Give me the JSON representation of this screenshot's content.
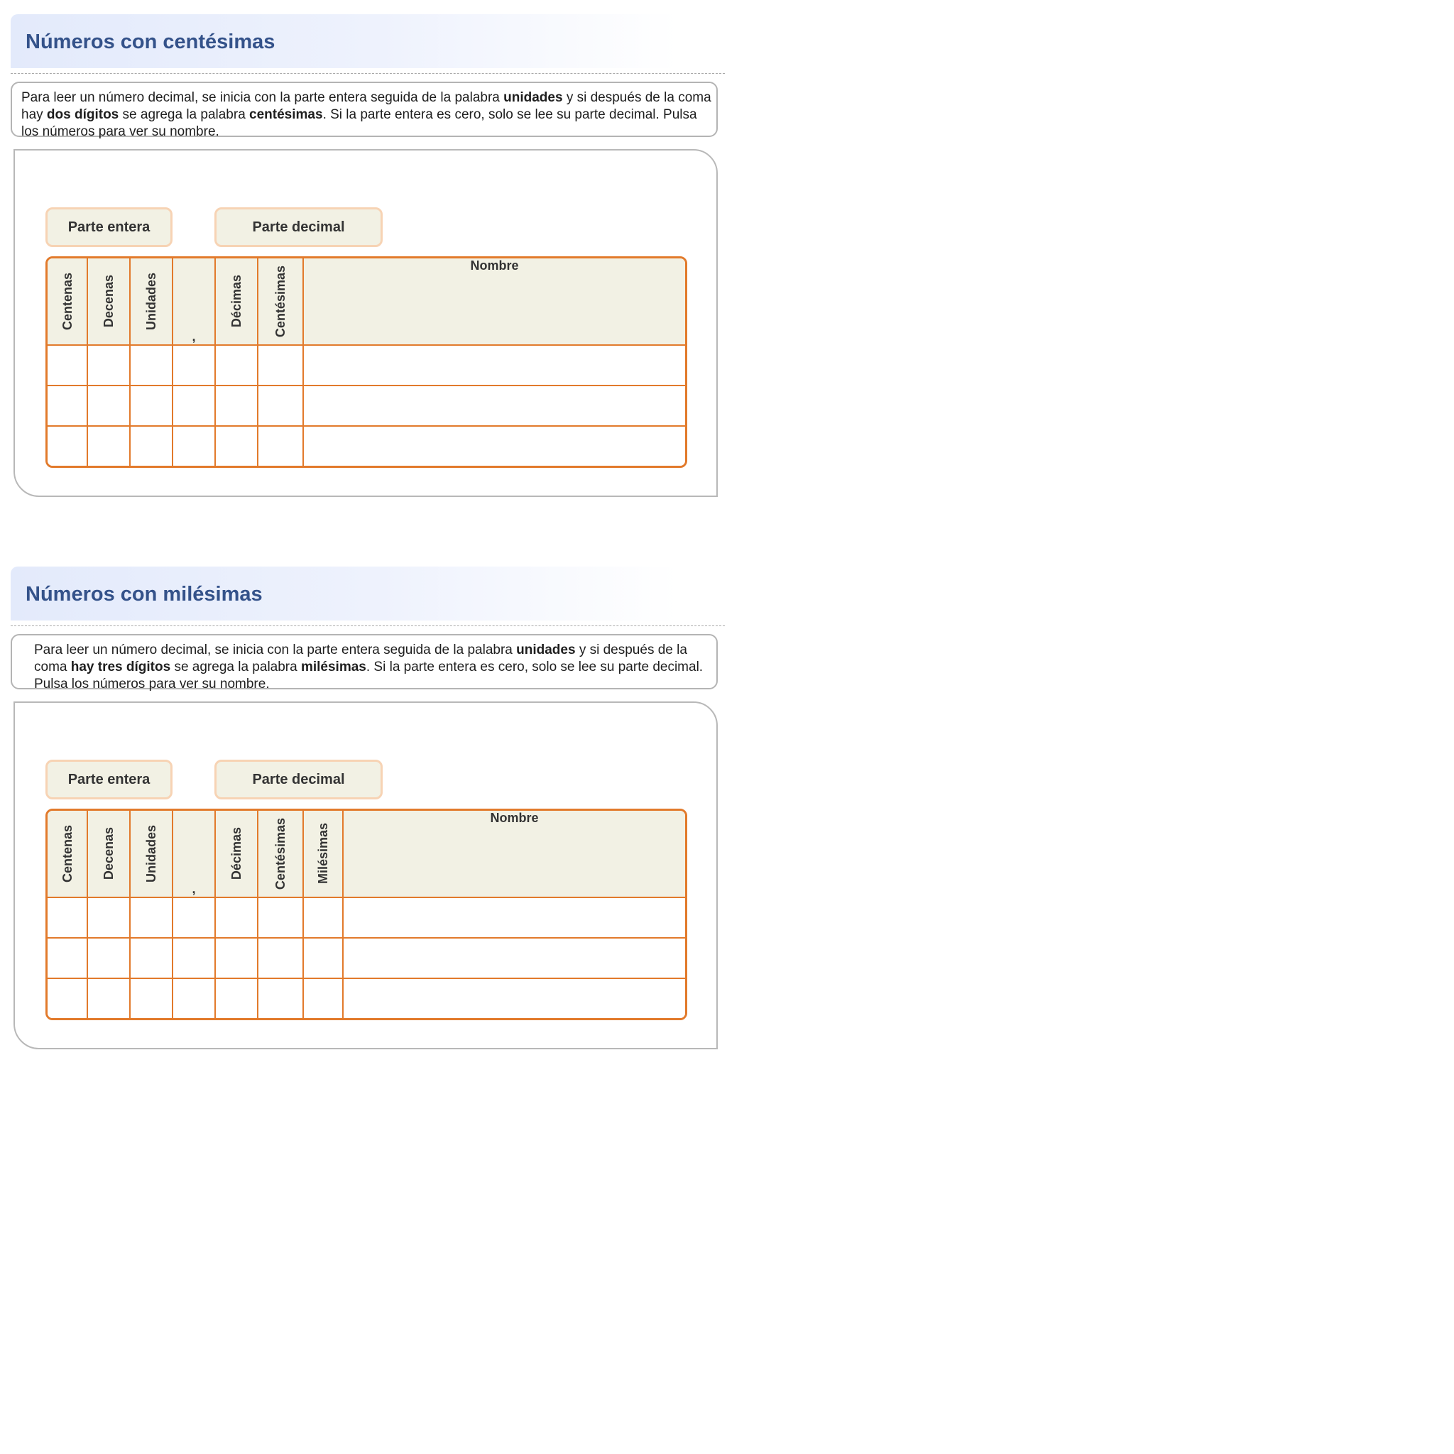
{
  "sections": [
    {
      "title": "Números con centésimas",
      "intro": {
        "t1": "Para leer un número decimal, se inicia con la parte entera seguida de la palabra ",
        "b1": "unidades",
        "t2": " y si después de la coma hay ",
        "b2": "dos dígitos",
        "t3": " se agrega la palabra ",
        "b3": "centésimas",
        "t4": ". Si la parte entera es cero, solo se lee su parte decimal. Pulsa los números para ver su nombre."
      },
      "tag_entera": "Parte entera",
      "tag_decimal": "Parte decimal",
      "columns": [
        "Centenas",
        "Decenas",
        "Unidades",
        ",",
        "Décimas",
        "Centésimas",
        "Nombre"
      ]
    },
    {
      "title": "Números con milésimas",
      "intro": {
        "t1": "Para leer un número decimal, se inicia con la parte entera seguida de la palabra ",
        "b1": "unidades",
        "t2": " y si después de la coma ",
        "b2": "hay tres dígitos",
        "t3": " se agrega la palabra ",
        "b3": "milésimas",
        "t4": ". Si la parte entera es cero, solo se lee su parte decimal. Pulsa los números para ver su nombre."
      },
      "tag_entera": "Parte entera",
      "tag_decimal": "Parte decimal",
      "columns": [
        "Centenas",
        "Decenas",
        "Unidades",
        ",",
        "Décimas",
        "Centésimas",
        "Milésimas",
        "Nombre"
      ]
    }
  ]
}
